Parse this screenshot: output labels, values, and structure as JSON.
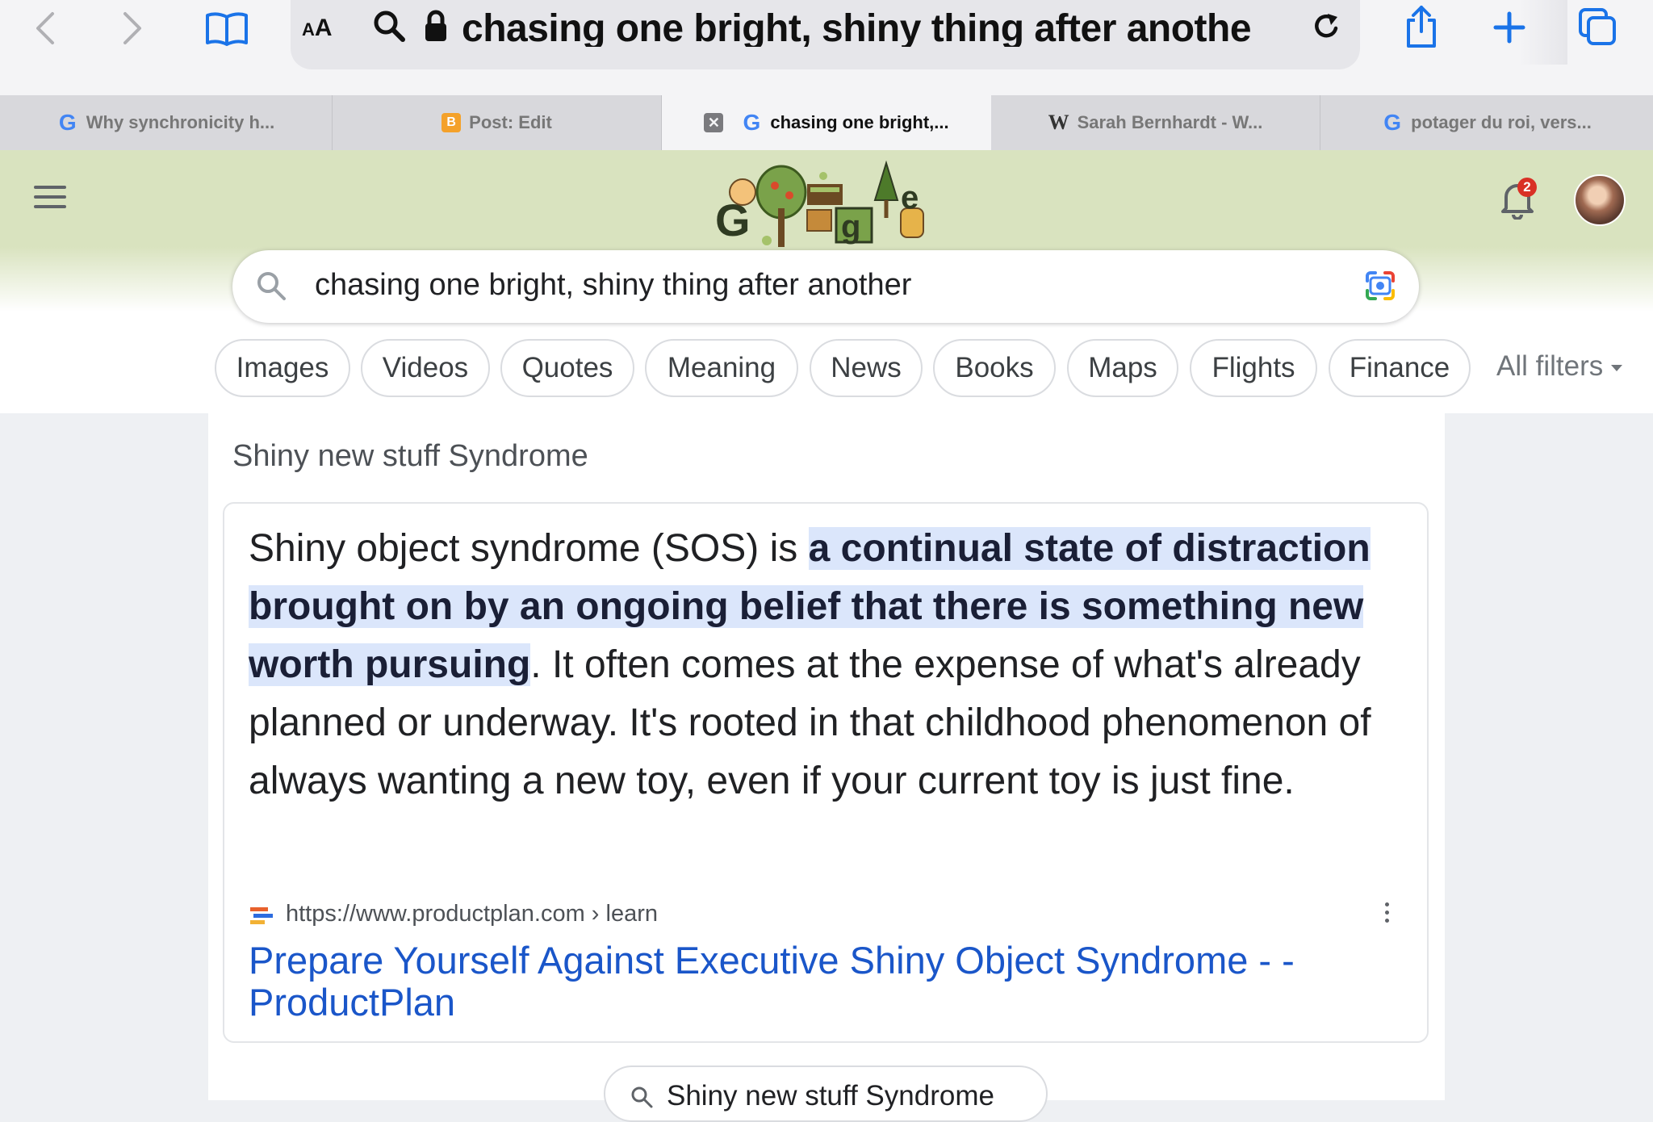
{
  "browser": {
    "aa_label_small": "A",
    "aa_label_big": "A",
    "url_text": "chasing one bright, shiny thing after anothe",
    "tabs": [
      {
        "label": "Why synchronicity h...",
        "favicon": "google-g-icon"
      },
      {
        "label": "Post: Edit",
        "favicon": "blogger-icon"
      },
      {
        "label": "chasing one bright,...",
        "favicon": "google-g-icon",
        "active": true
      },
      {
        "label": "Sarah Bernhardt - W...",
        "favicon": "wikipedia-w-icon"
      },
      {
        "label": "potager du roi, vers...",
        "favicon": "google-g-icon"
      }
    ],
    "favicon_letters": {
      "google": "G",
      "blogger": "B",
      "wikipedia": "W"
    },
    "accent_color": "#1a73e8"
  },
  "google": {
    "notification_count": "2",
    "search_query": "chasing one bright, shiny thing after another",
    "chips": [
      "Images",
      "Videos",
      "Quotes",
      "Meaning",
      "News",
      "Books",
      "Maps",
      "Flights",
      "Finance"
    ],
    "all_filters_label": "All filters",
    "header_color": "#d9e3bf"
  },
  "featured": {
    "title": "Shiny new stuff Syndrome",
    "snippet_before": "Shiny object syndrome (SOS) is ",
    "snippet_highlight": "a continual state of distraction brought on by an ongoing belief that there is something new worth pursuing",
    "snippet_after": ". It often comes at the expense of what's already planned or underway. It's rooted in that childhood phenomenon of always wanting a new toy, even if your current toy is just fine.",
    "source_url": "https://www.productplan.com › learn",
    "link_title": "Prepare Yourself Against Executive Shiny Object Syndrome - - ProductPlan",
    "link_color": "#1a56c9",
    "highlight_color": "#dbe6fb"
  },
  "related": {
    "chip_label": "Shiny new stuff Syndrome"
  }
}
